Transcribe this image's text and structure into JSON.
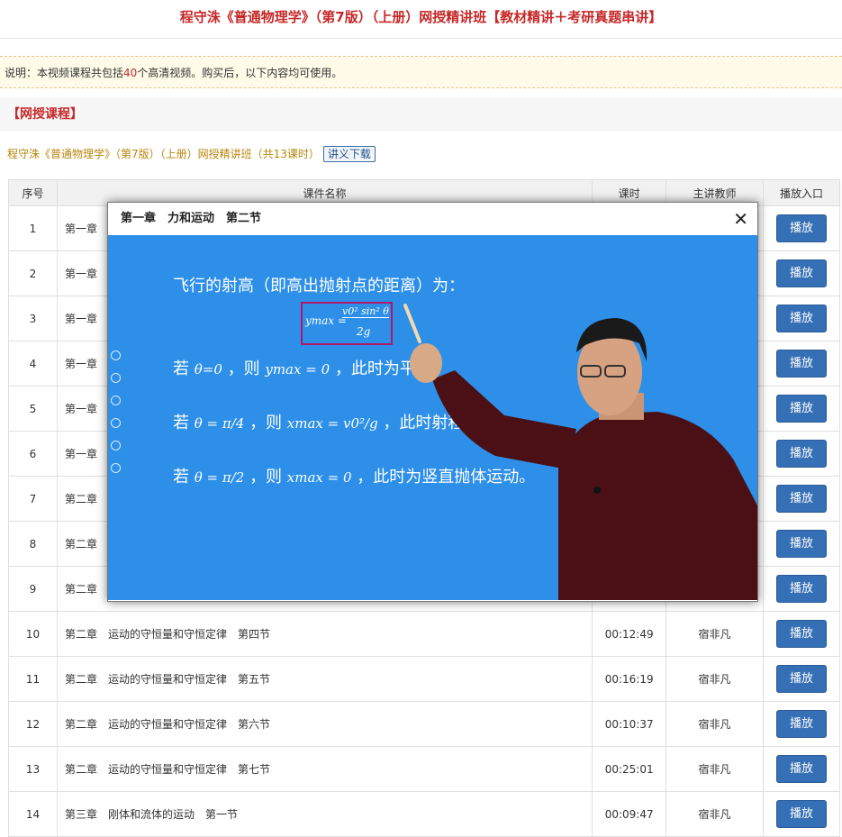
{
  "page": {
    "title": "程守洙《普通物理学》（第7版）（上册）网授精讲班【教材精讲＋考研真题串讲】",
    "notice_prefix": "说明：本视频课程共包括",
    "notice_count": "40",
    "notice_suffix": "个高清视频。购买后，以下内容均可使用。",
    "section_title": "【网授课程】",
    "course_name": "程守洙《普通物理学》（第7版）（上册）网授精讲班（共13课时）",
    "download_label": "讲义下载"
  },
  "table": {
    "headers": [
      "序号",
      "课件名称",
      "课时",
      "主讲教师",
      "播放入口"
    ],
    "play_label": "播放",
    "rows": [
      {
        "no": "1",
        "name": "第一章",
        "duration": "",
        "teacher": ""
      },
      {
        "no": "2",
        "name": "第一章",
        "duration": "",
        "teacher": ""
      },
      {
        "no": "3",
        "name": "第一章",
        "duration": "",
        "teacher": ""
      },
      {
        "no": "4",
        "name": "第一章",
        "duration": "",
        "teacher": ""
      },
      {
        "no": "5",
        "name": "第一章",
        "duration": "",
        "teacher": ""
      },
      {
        "no": "6",
        "name": "第一章",
        "duration": "",
        "teacher": ""
      },
      {
        "no": "7",
        "name": "第二章",
        "duration": "",
        "teacher": ""
      },
      {
        "no": "8",
        "name": "第二章",
        "duration": "",
        "teacher": ""
      },
      {
        "no": "9",
        "name": "第二章",
        "duration": "",
        "teacher": ""
      },
      {
        "no": "10",
        "name": "第二章　运动的守恒量和守恒定律　第四节",
        "duration": "00:12:49",
        "teacher": "宿非凡"
      },
      {
        "no": "11",
        "name": "第二章　运动的守恒量和守恒定律　第五节",
        "duration": "00:16:19",
        "teacher": "宿非凡"
      },
      {
        "no": "12",
        "name": "第二章　运动的守恒量和守恒定律　第六节",
        "duration": "00:10:37",
        "teacher": "宿非凡"
      },
      {
        "no": "13",
        "name": "第二章　运动的守恒量和守恒定律　第七节",
        "duration": "00:25:01",
        "teacher": "宿非凡"
      },
      {
        "no": "14",
        "name": "第三章　刚体和流体的运动　第一节",
        "duration": "00:09:47",
        "teacher": "宿非凡"
      }
    ]
  },
  "modal": {
    "title": "第一章　力和运动　第二节",
    "close_glyph": "✕",
    "slide": {
      "line1": "飞行的射高（即高出抛射点的距离）为：",
      "formula_lhs": "ymax =",
      "formula_num": "v0² sin² θ",
      "formula_den": "2g",
      "line2_a": "若",
      "line2_b": "θ=0",
      "line2_c": "，则",
      "line2_d": "ymax = 0",
      "line2_e": "，此时为平抛",
      "line3_a": "若",
      "line3_b": "θ = π/4",
      "line3_c": "，则",
      "line3_d": "xmax = v0²/g",
      "line3_e": "，此时射程最大；",
      "line4_a": "若",
      "line4_b": "θ = π/2",
      "line4_c": "，则",
      "line4_d": "xmax = 0",
      "line4_e": "，此时为竖直抛体运动。"
    }
  },
  "colors": {
    "accent_red": "#c62828",
    "play_blue": "#356fb5",
    "slide_blue": "#2d8fe8"
  }
}
